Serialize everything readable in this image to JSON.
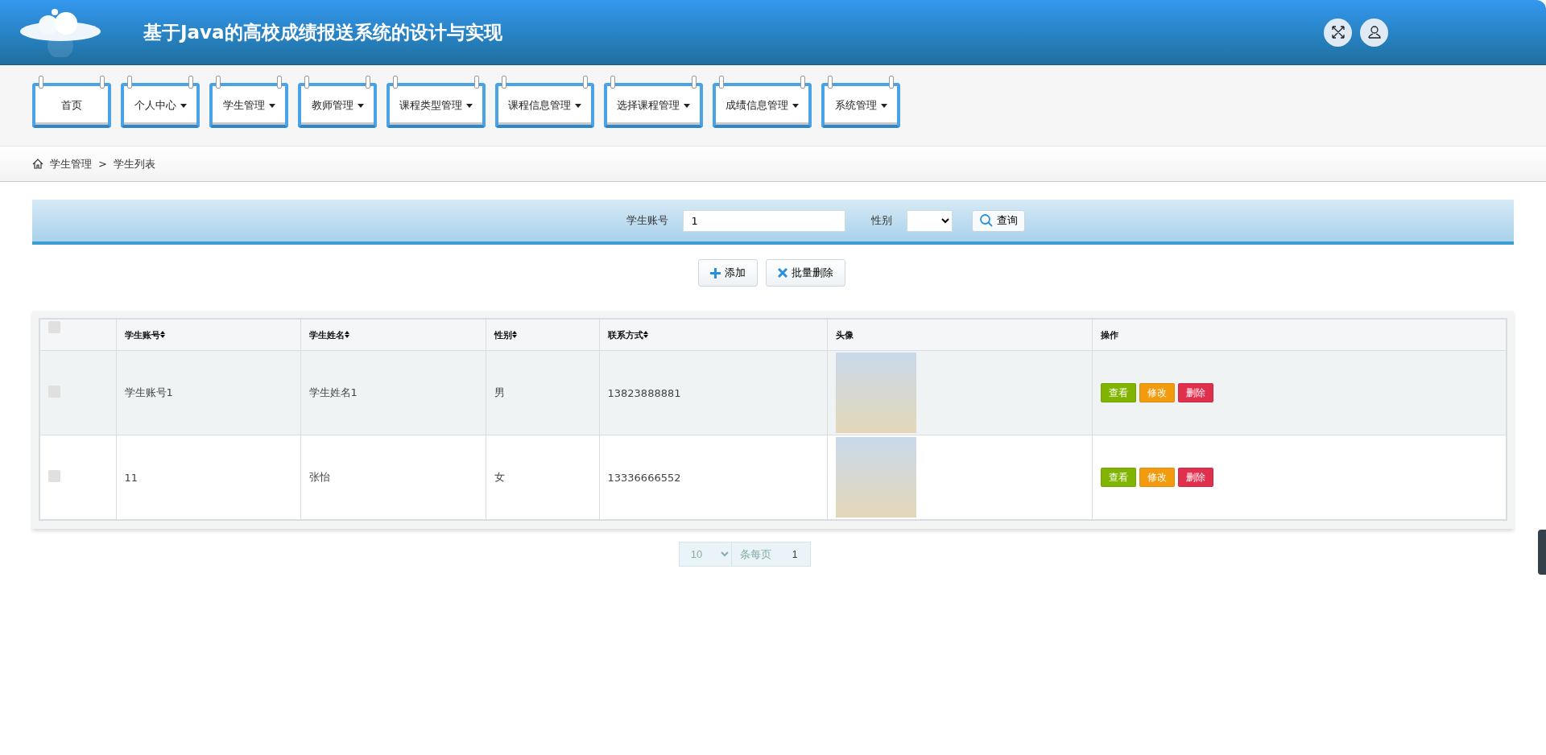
{
  "header": {
    "title": "基于Java的高校成绩报送系统的设计与实现"
  },
  "nav": [
    {
      "label": "首页",
      "kind": "link"
    },
    {
      "label": "个人中心",
      "kind": "dropdown"
    },
    {
      "label": "学生管理",
      "kind": "dropdown"
    },
    {
      "label": "教师管理",
      "kind": "dropdown"
    },
    {
      "label": "课程类型管理",
      "kind": "dropdown"
    },
    {
      "label": "课程信息管理",
      "kind": "dropdown"
    },
    {
      "label": "选择课程管理",
      "kind": "dropdown"
    },
    {
      "label": "成绩信息管理",
      "kind": "dropdown"
    },
    {
      "label": "系统管理",
      "kind": "dropdown"
    }
  ],
  "breadcrumb": [
    "学生管理",
    "学生列表"
  ],
  "breadcrumb_separator": ">",
  "search": {
    "fields": [
      {
        "label": "学生账号",
        "kind": "text",
        "value": "1"
      },
      {
        "label": "性别",
        "kind": "select"
      }
    ],
    "button": "查询"
  },
  "actions": [
    {
      "label": "添加",
      "kind": "add"
    },
    {
      "label": "批量删除",
      "kind": "delete"
    }
  ],
  "table": {
    "select_all_checked": false,
    "columns": [
      {
        "label": "学生账号",
        "sortable": true
      },
      {
        "label": "学生姓名",
        "sortable": true
      },
      {
        "label": "性别",
        "sortable": true
      },
      {
        "label": "联系方式",
        "sortable": true
      },
      {
        "label": "头像",
        "sortable": false
      },
      {
        "label": "操作",
        "sortable": false
      }
    ],
    "rows": [
      {
        "checked": false,
        "highlighted": true,
        "cells": [
          "学生账号1",
          "学生姓名1",
          "男",
          "13823888881"
        ],
        "buttons": [
          "查看",
          "修改",
          "删除"
        ]
      },
      {
        "checked": false,
        "highlighted": false,
        "cells": [
          "11",
          "张怡",
          "女",
          "13336666552"
        ],
        "buttons": [
          "查看",
          "修改",
          "删除"
        ]
      }
    ]
  },
  "pagination": {
    "page_size": "10",
    "page_size_label": "条每页",
    "pages": [
      {
        "label": "1",
        "selected": true
      }
    ]
  }
}
